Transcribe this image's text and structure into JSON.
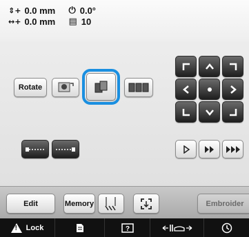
{
  "status": {
    "y_icon": "vertical-offset-icon",
    "y_value": "0.0 mm",
    "x_icon": "horizontal-offset-icon",
    "x_value": "0.0 mm",
    "angle_icon": "rotation-angle-icon",
    "angle_value": "0.0°",
    "spool_icon": "thread-spool-icon",
    "color_count": "10"
  },
  "edit_buttons": {
    "rotate_label": "Rotate"
  },
  "toolbar": {
    "edit_label": "Edit",
    "memory_label": "Memory",
    "embroider_label": "Embroider"
  },
  "bottom_bar": {
    "lock_label": "Lock"
  },
  "colors": {
    "selection_highlight": "#1a8fe0",
    "dark_button": "#2a2a2a",
    "bottom_bar": "#111111"
  }
}
